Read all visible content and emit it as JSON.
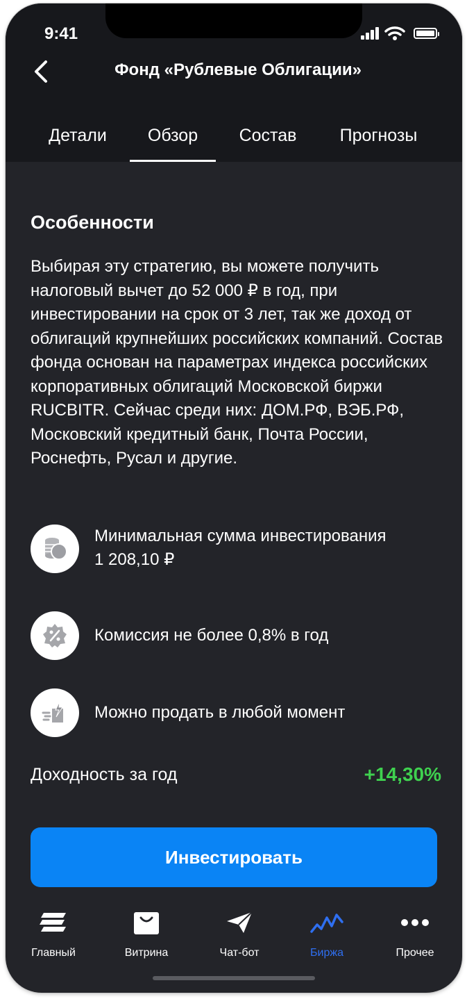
{
  "status_bar": {
    "time": "9:41"
  },
  "header": {
    "title": "Фонд «Рублевые Облигации»"
  },
  "tabs": [
    {
      "label": "Детали",
      "active": false
    },
    {
      "label": "Обзор",
      "active": true
    },
    {
      "label": "Состав",
      "active": false
    },
    {
      "label": "Прогнозы",
      "active": false
    }
  ],
  "features_section": {
    "title": "Особенности",
    "description": "Выбирая эту стратегию, вы можете получить налоговый вычет до 52 000 ₽ в год, при инвестировании на срок от 3 лет, так же доход от облигаций крупнейших российских компаний. Состав фонда основан на параметрах индекса российских корпоративных облигаций Московской биржи RUCBITR. Сейчас среди них: ДОМ.РФ, ВЭБ.РФ, Московский кредитный банк, Почта России, Роснефть, Русал и другие."
  },
  "features": [
    {
      "icon": "coins-icon",
      "text": "Минимальная сумма инвестирования",
      "value": "1 208,10 ₽"
    },
    {
      "icon": "percent-badge-icon",
      "text": "Комиссия не более 0,8% в год"
    },
    {
      "icon": "fast-sell-icon",
      "text": "Можно продать в любой момент"
    }
  ],
  "yield": {
    "label": "Доходность за год",
    "value": "+14,30%",
    "color": "#3fd14f"
  },
  "invest_button": {
    "label": "Инвестировать",
    "color": "#0a84f5"
  },
  "nav": [
    {
      "label": "Главный",
      "icon": "stack-icon",
      "active": false
    },
    {
      "label": "Витрина",
      "icon": "shopping-bag-icon",
      "active": false
    },
    {
      "label": "Чат-бот",
      "icon": "paper-plane-icon",
      "active": false
    },
    {
      "label": "Биржа",
      "icon": "stock-chart-icon",
      "active": true
    },
    {
      "label": "Прочее",
      "icon": "more-dots-icon",
      "active": false
    }
  ],
  "colors": {
    "background": "#232429",
    "header_background": "#17181c",
    "accent": "#2f6ff0"
  }
}
